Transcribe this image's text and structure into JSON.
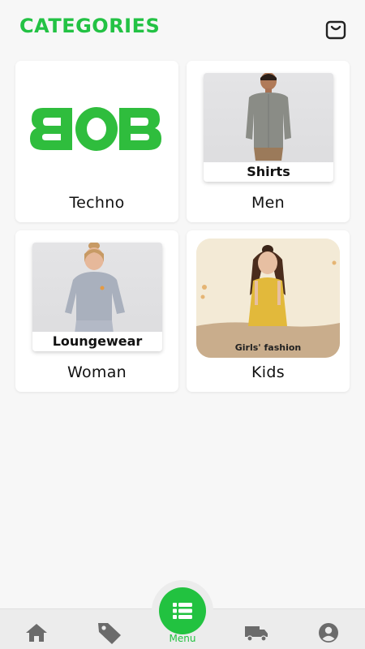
{
  "header": {
    "title": "CATEGORIES",
    "bag_icon": "shopping-bag-icon"
  },
  "colors": {
    "accent": "#23c244",
    "background": "#f7f7f7",
    "card": "#ffffff",
    "nav": "#ececec",
    "nav_icon": "#6b6b6b"
  },
  "categories": [
    {
      "label": "Techno",
      "image_text": "BOB"
    },
    {
      "label": "Men",
      "image_caption": "Shirts"
    },
    {
      "label": "Woman",
      "image_caption": "Loungewear"
    },
    {
      "label": "Kids",
      "image_caption": "Girls' fashion"
    }
  ],
  "bottom_nav": {
    "items": [
      {
        "icon": "home-icon"
      },
      {
        "icon": "tag-icon"
      },
      {
        "icon": "menu-list-icon",
        "label": "Menu"
      },
      {
        "icon": "truck-icon"
      },
      {
        "icon": "account-icon"
      }
    ]
  }
}
